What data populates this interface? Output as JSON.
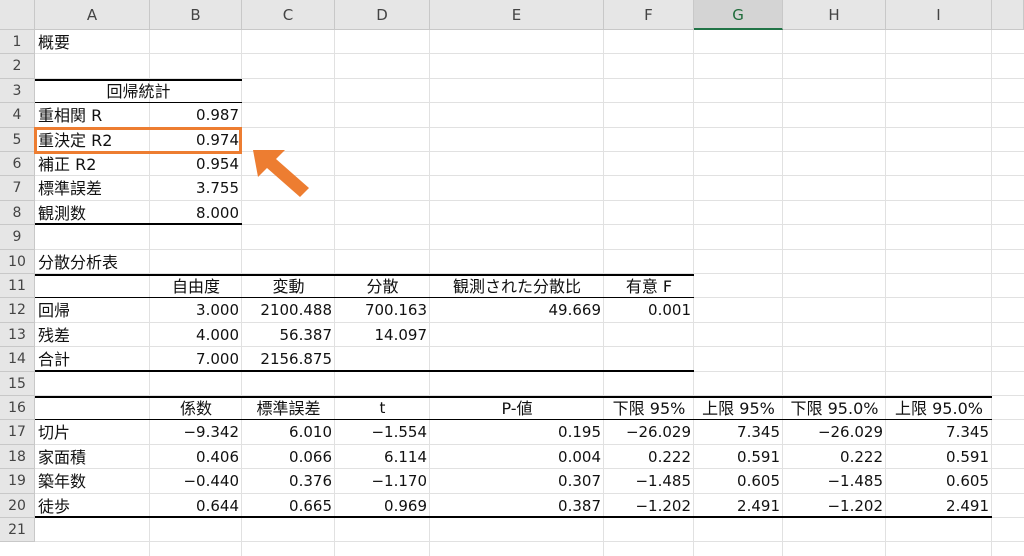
{
  "sheet": {
    "columns": [
      "A",
      "B",
      "C",
      "D",
      "E",
      "F",
      "G",
      "H",
      "I"
    ],
    "rows": [
      "1",
      "2",
      "3",
      "4",
      "5",
      "6",
      "7",
      "8",
      "9",
      "10",
      "11",
      "12",
      "13",
      "14",
      "15",
      "16",
      "17",
      "18",
      "19",
      "20",
      "21"
    ],
    "selected_column": "G"
  },
  "summary": {
    "title": "概要",
    "regression_stats_header": "回帰統計",
    "stats": [
      {
        "label": "重相関 R",
        "value": "0.987"
      },
      {
        "label": "重決定 R2",
        "value": "0.974"
      },
      {
        "label": "補正 R2",
        "value": "0.954"
      },
      {
        "label": "標準誤差",
        "value": "3.755"
      },
      {
        "label": "観測数",
        "value": "8.000"
      }
    ]
  },
  "anova": {
    "title": "分散分析表",
    "headers": [
      "自由度",
      "変動",
      "分散",
      "観測された分散比",
      "有意 F"
    ],
    "rows": [
      {
        "label": "回帰",
        "values": [
          "3.000",
          "2100.488",
          "700.163",
          "49.669",
          "0.001"
        ]
      },
      {
        "label": "残差",
        "values": [
          "4.000",
          "56.387",
          "14.097",
          "",
          ""
        ]
      },
      {
        "label": "合計",
        "values": [
          "7.000",
          "2156.875",
          "",
          "",
          ""
        ]
      }
    ]
  },
  "coefficients": {
    "headers": [
      "係数",
      "標準誤差",
      "t",
      "P-値",
      "下限 95%",
      "上限 95%",
      "下限 95.0%",
      "上限 95.0%"
    ],
    "rows": [
      {
        "label": "切片",
        "values": [
          "−9.342",
          "6.010",
          "−1.554",
          "0.195",
          "−26.029",
          "7.345",
          "−26.029",
          "7.345"
        ]
      },
      {
        "label": "家面積",
        "values": [
          "0.406",
          "0.066",
          "6.114",
          "0.004",
          "0.222",
          "0.591",
          "0.222",
          "0.591"
        ]
      },
      {
        "label": "築年数",
        "values": [
          "−0.440",
          "0.376",
          "−1.170",
          "0.307",
          "−1.485",
          "0.605",
          "−1.485",
          "0.605"
        ]
      },
      {
        "label": "徒歩",
        "values": [
          "0.644",
          "0.665",
          "0.969",
          "0.387",
          "−1.202",
          "2.491",
          "−1.202",
          "2.491"
        ]
      }
    ]
  },
  "annotation": {
    "highlight_color": "#ed7d31",
    "highlight_target": "重決定 R2"
  }
}
